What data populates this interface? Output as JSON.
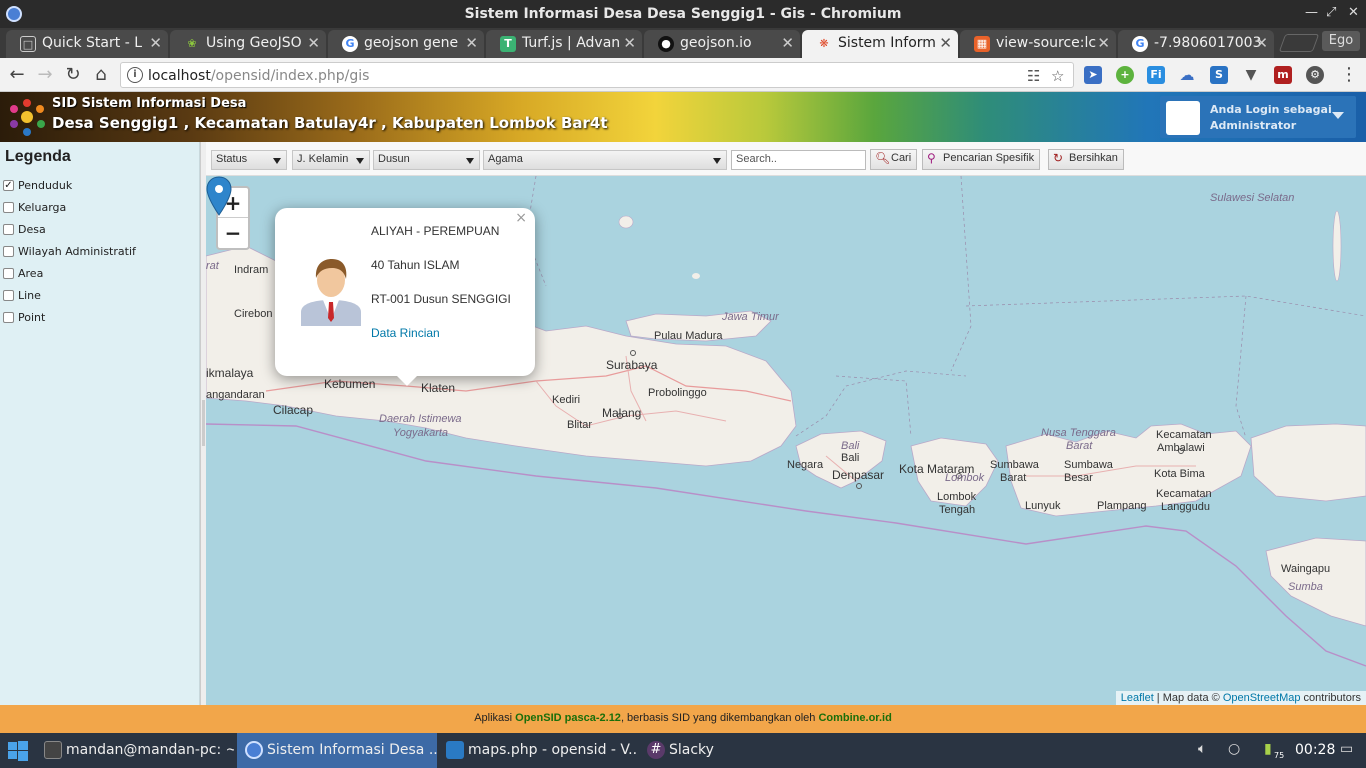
{
  "window": {
    "title": "Sistem Informasi Desa Desa Senggig1 - Gis - Chromium"
  },
  "tabs": [
    {
      "label": "Quick Start - L",
      "icon": "doc-icon"
    },
    {
      "label": "Using GeoJSO",
      "icon": "leaf-icon"
    },
    {
      "label": "geojson gene",
      "icon": "google-icon"
    },
    {
      "label": "Turf.js | Advan",
      "icon": "turf-icon"
    },
    {
      "label": "geojson.io",
      "icon": "github-icon"
    },
    {
      "label": "Sistem Inform",
      "icon": "opensid-icon"
    },
    {
      "label": "view-source:lc",
      "icon": "viewsource-icon"
    },
    {
      "label": "-7.9806017003",
      "icon": "google-icon"
    }
  ],
  "profile_chip": "Ego",
  "address": {
    "host": "localhost",
    "path": "/opensid/index.php/gis"
  },
  "site": {
    "title": "SID Sistem Informasi Desa",
    "subtitle": "Desa Senggig1 , Kecamatan Batulay4r , Kabupaten Lombok Bar4t",
    "login_line1": "Anda Login sebagai",
    "login_line2": "Administrator"
  },
  "sidebar": {
    "heading": "Legenda",
    "items": [
      {
        "label": "Penduduk",
        "checked": true
      },
      {
        "label": "Keluarga",
        "checked": false
      },
      {
        "label": "Desa",
        "checked": false
      },
      {
        "label": "Wilayah Administratif",
        "checked": false
      },
      {
        "label": "Area",
        "checked": false
      },
      {
        "label": "Line",
        "checked": false
      },
      {
        "label": "Point",
        "checked": false
      }
    ]
  },
  "filters": {
    "status": "Status",
    "gender": "J. Kelamin",
    "dusun": "Dusun",
    "agama": "Agama",
    "search_placeholder": "Search..",
    "cari": "Cari",
    "spesifik": "Pencarian Spesifik",
    "bersihkan": "Bersihkan"
  },
  "map": {
    "labels": {
      "sulawesi": "Sulawesi Selatan",
      "jawa_timur": "Jawa Timur",
      "pulau_madura": "Pulau Madura",
      "surabaya": "Surabaya",
      "probolinggo": "Probolinggo",
      "kediri": "Kediri",
      "malang": "Malang",
      "blitar": "Blitar",
      "klaten": "Klaten",
      "kebumen": "Kebumen",
      "cilacap": "Cilacap",
      "diy1": "Daerah Istimewa",
      "diy2": "Yogyakarta",
      "rat": "rat",
      "indram": "Indram",
      "cirebon": "Cirebon",
      "ikmalaya": "ikmalaya",
      "angandaran": "angandaran",
      "bali_it": "Bali",
      "bali": "Bali",
      "negara": "Negara",
      "denpasar": "Denpasar",
      "kota_mataram": "Kota Mataram",
      "lombok_it": "Lombok",
      "lombok_tengah1": "Lombok",
      "lombok_tengah2": "Tengah",
      "sumbawa_barat1": "Sumbawa",
      "sumbawa_barat2": "Barat",
      "sumbawa_besar1": "Sumbawa",
      "sumbawa_besar2": "Besar",
      "ntb1": "Nusa Tenggara",
      "ntb2": "Barat",
      "lunyuk": "Lunyuk",
      "plampang": "Plampang",
      "kec_ambalawi1": "Kecamatan",
      "kec_ambalawi2": "Ambalawi",
      "kota_bima": "Kota Bima",
      "kec_langgudu1": "Kecamatan",
      "kec_langgudu2": "Langgudu",
      "waingapu": "Waingapu",
      "sumba": "Sumba"
    },
    "popup": {
      "name": "ALIYAH - PEREMPUAN",
      "age": "40 Tahun ISLAM",
      "address": "RT-001 Dusun SENGGIGI",
      "link": "Data Rincian"
    },
    "attribution": {
      "leaflet": "Leaflet",
      "mapdata": " | Map data © ",
      "osm": "OpenStreetMap",
      "contrib": " contributors"
    }
  },
  "footer": {
    "pre": "Aplikasi ",
    "app": "OpenSID pasca-2.12",
    "mid": ", berbasis SID yang dikembangkan oleh ",
    "by": "Combine.or.id"
  },
  "taskbar": {
    "tasks": [
      {
        "label": "mandan@mandan-pc: ~"
      },
      {
        "label": "Sistem Informasi Desa ..."
      },
      {
        "label": "maps.php - opensid - V..."
      },
      {
        "label": "Slacky"
      }
    ],
    "battery": "75",
    "clock": "00:28"
  }
}
